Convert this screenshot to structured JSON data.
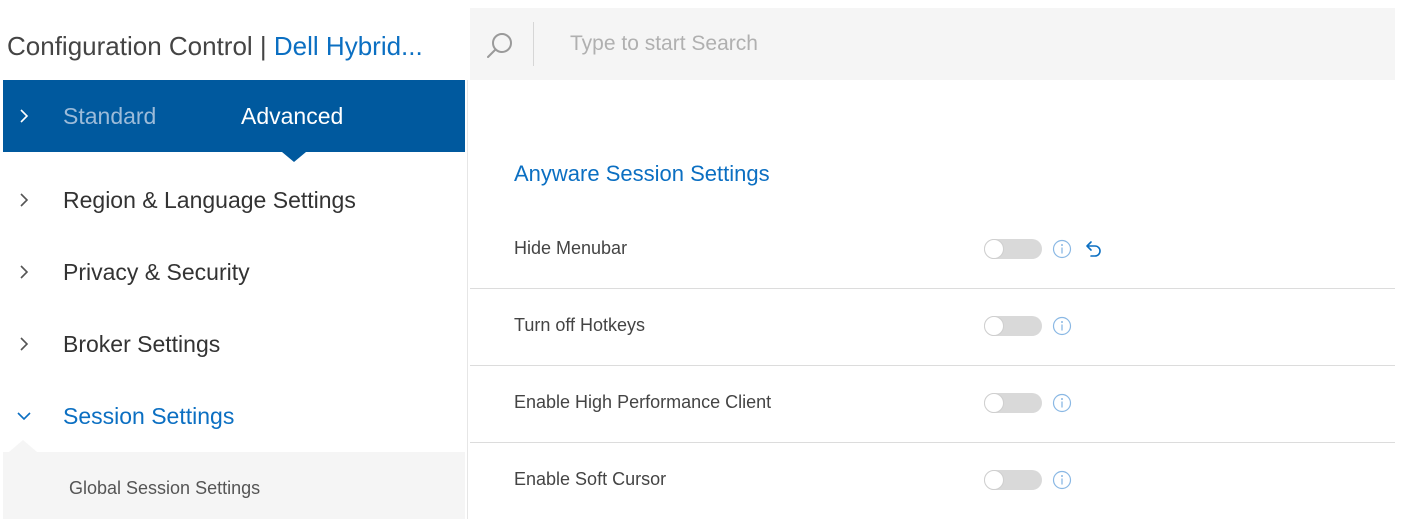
{
  "header": {
    "title_prefix": "Configuration Control | ",
    "title_product": "Dell Hybrid..."
  },
  "search": {
    "placeholder": "Type to start Search",
    "value": "",
    "icon": "search-icon"
  },
  "sidebar": {
    "mode_tabs": [
      {
        "label": "Standard",
        "active": false
      },
      {
        "label": "Advanced",
        "active": true
      }
    ],
    "items": [
      {
        "label": "Region & Language Settings",
        "expanded": false
      },
      {
        "label": "Privacy & Security",
        "expanded": false
      },
      {
        "label": "Broker Settings",
        "expanded": false
      },
      {
        "label": "Session Settings",
        "expanded": true
      }
    ],
    "sub_items": [
      {
        "label": "Global Session Settings"
      }
    ]
  },
  "main": {
    "section_title": "Anyware Session Settings",
    "settings": [
      {
        "label": "Hide Menubar",
        "enabled": false,
        "has_reset": true
      },
      {
        "label": "Turn off Hotkeys",
        "enabled": false,
        "has_reset": false
      },
      {
        "label": "Enable High Performance Client",
        "enabled": false,
        "has_reset": false
      },
      {
        "label": "Enable Soft Cursor",
        "enabled": false,
        "has_reset": false
      }
    ]
  },
  "colors": {
    "accent_blue": "#0b6fc2",
    "nav_bar_blue": "#00599e",
    "toggle_off": "#d9d9d9",
    "panel_gray": "#f5f5f5"
  }
}
